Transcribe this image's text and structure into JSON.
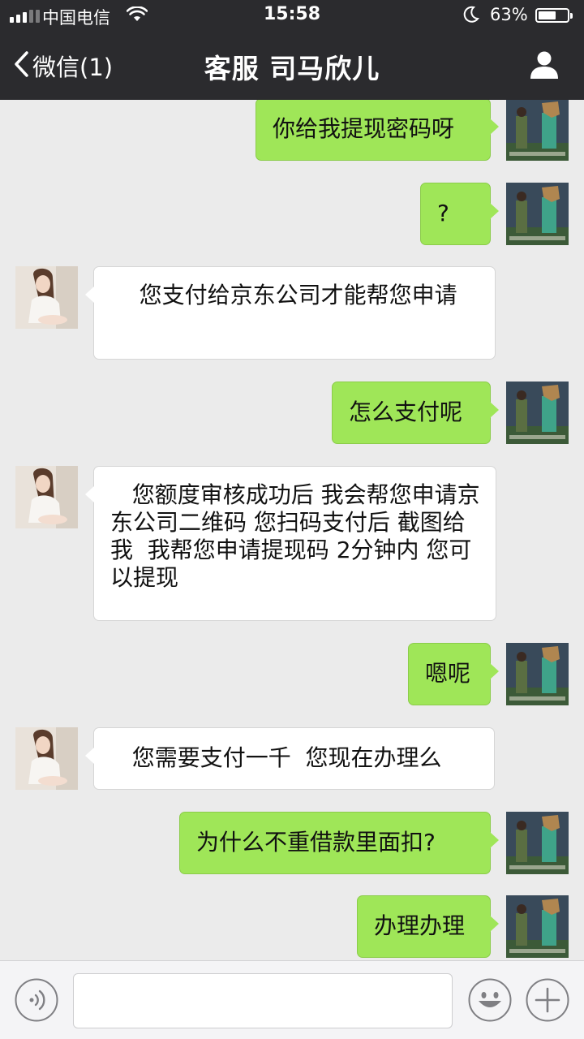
{
  "status_bar": {
    "carrier": "中国电信",
    "time": "15:58",
    "battery_percent": "63%",
    "battery_level": 0.63,
    "signal_bars": 5,
    "signal_bars_active": 3,
    "icons": [
      "wifi-icon",
      "moon-icon",
      "battery-icon"
    ]
  },
  "nav": {
    "back_label": "微信(1)",
    "title": "客服  司马欣儿",
    "icons": [
      "chevron-left-icon",
      "profile-icon"
    ]
  },
  "chat": {
    "colors": {
      "outgoing_bubble": "#9fe658",
      "incoming_bubble": "#ffffff",
      "background": "#ebebeb"
    },
    "messages": [
      {
        "side": "out",
        "text": "你给我提现密码呀",
        "avatar": "horse-mask-avatar"
      },
      {
        "side": "out",
        "text": "?",
        "avatar": "horse-mask-avatar"
      },
      {
        "side": "in",
        "text": "    您支付给京东公司才能帮您申请",
        "avatar": "agent-avatar"
      },
      {
        "side": "out",
        "text": "怎么支付呢",
        "avatar": "horse-mask-avatar"
      },
      {
        "side": "in",
        "text": "   您额度审核成功后 我会帮您申请京东公司二维码 您扫码支付后 截图给我  我帮您申请提现码 2分钟内 您可以提现",
        "avatar": "agent-avatar"
      },
      {
        "side": "out",
        "text": "嗯呢",
        "avatar": "horse-mask-avatar"
      },
      {
        "side": "in",
        "text": "   您需要支付一千  您现在办理么",
        "avatar": "agent-avatar"
      },
      {
        "side": "out",
        "text": "为什么不重借款里面扣?",
        "avatar": "horse-mask-avatar"
      },
      {
        "side": "out",
        "text": "办理办理",
        "avatar": "horse-mask-avatar"
      }
    ]
  },
  "input_bar": {
    "text_value": "",
    "icons": [
      "voice-icon",
      "emoji-icon",
      "plus-icon"
    ]
  }
}
